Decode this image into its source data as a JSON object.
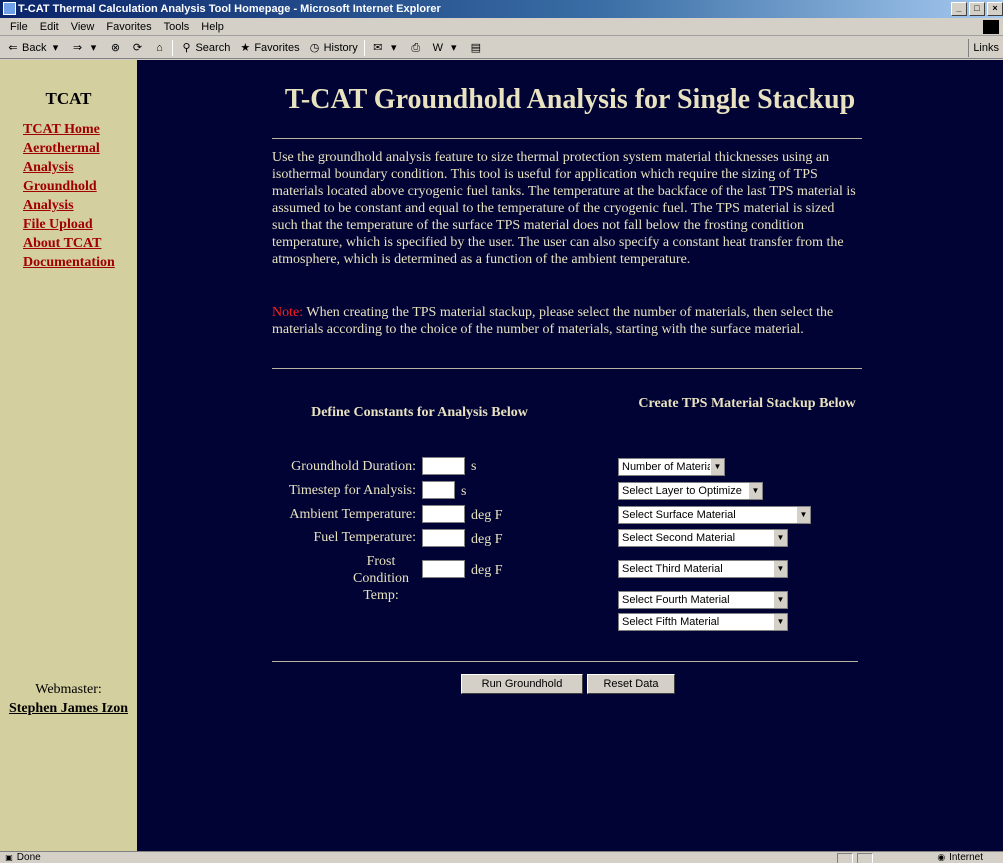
{
  "window": {
    "title": "T-CAT Thermal Calculation Analysis Tool Homepage - Microsoft Internet Explorer",
    "minimize": "_",
    "maximize": "□",
    "close": "×"
  },
  "menu": [
    "File",
    "Edit",
    "View",
    "Favorites",
    "Tools",
    "Help"
  ],
  "toolbar": {
    "back": "Back",
    "search": "Search",
    "favorites": "Favorites",
    "history": "History",
    "links": "Links"
  },
  "sidebar": {
    "title": "TCAT",
    "nav": [
      {
        "label": "TCAT Home"
      },
      {
        "label": "Aerothermal Analysis"
      },
      {
        "label": "Groundhold Analysis"
      },
      {
        "label": "File Upload"
      },
      {
        "label": "About TCAT"
      },
      {
        "label": "Documentation"
      }
    ],
    "webmaster_label": "Webmaster:",
    "webmaster_name": "Stephen James Izon"
  },
  "main": {
    "title": "T-CAT Groundhold Analysis for Single Stackup",
    "intro": "Use the groundhold analysis feature to size thermal protection system material thicknesses using an isothermal boundary condition. This tool is useful for application which require the sizing of TPS materials located above cryogenic fuel tanks. The temperature at the backface of the last TPS material is assumed to be constant and equal to the temperature of the cryogenic fuel. The TPS material is sized such that the temperature of the surface TPS material does not fall below the frosting condition temperature, which is specified by the user. The user can also specify a constant heat transfer from the atmosphere, which is determined as a function of the ambient temperature.",
    "note_label": "Note:",
    "note_text": " When creating the TPS material stackup, please select the number of materials, then select the materials according to the choice of the number of materials, starting with the surface material.",
    "constants_heading": "Define Constants for Analysis Below",
    "stackup_heading": "Create TPS Material Stackup Below",
    "fields": [
      {
        "label": "Groundhold Duration:",
        "unit": "s",
        "value": ""
      },
      {
        "label": "Timestep for Analysis:",
        "unit": "s",
        "value": ""
      },
      {
        "label": "Ambient Temperature:",
        "unit": "deg F",
        "value": ""
      },
      {
        "label": "Fuel Temperature:",
        "unit": "deg F",
        "value": ""
      },
      {
        "label": "Frost Condition Temp:",
        "unit": "deg F",
        "value": ""
      }
    ],
    "selects": [
      "Number of Materials",
      "Select Layer to Optimize",
      "Select Surface Material",
      "Select Second Material",
      "Select Third Material",
      "Select Fourth Material",
      "Select Fifth Material"
    ],
    "run_button": "Run Groundhold",
    "reset_button": "Reset Data"
  },
  "status": {
    "text": "Done",
    "zone": "Internet"
  }
}
